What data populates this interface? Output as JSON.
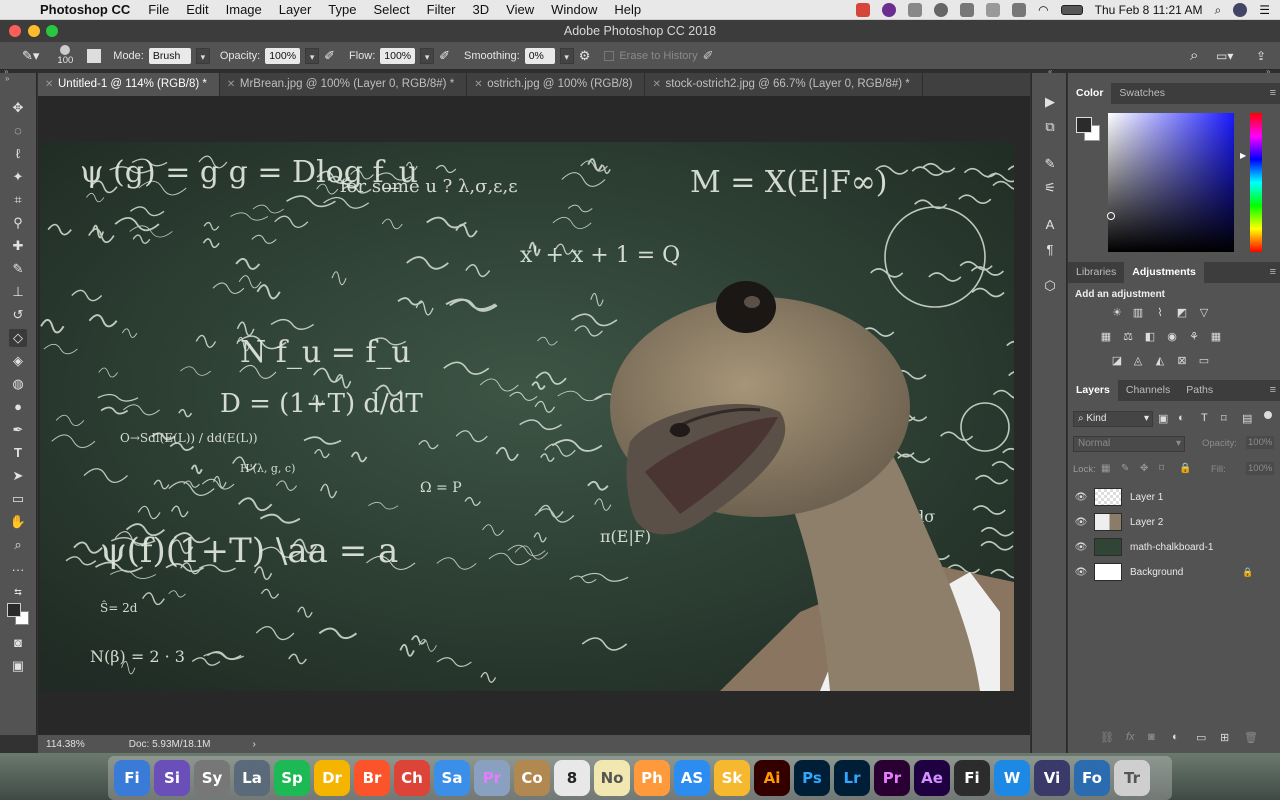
{
  "menubar": {
    "app_name": "Photoshop CC",
    "items": [
      "File",
      "Edit",
      "Image",
      "Layer",
      "Type",
      "Select",
      "Filter",
      "3D",
      "View",
      "Window",
      "Help"
    ],
    "clock": "Thu Feb 8  11:21 AM"
  },
  "window": {
    "title": "Adobe Photoshop CC 2018"
  },
  "options": {
    "brush_size": "100",
    "mode_label": "Mode:",
    "mode_value": "Brush",
    "opacity_label": "Opacity:",
    "opacity_value": "100%",
    "flow_label": "Flow:",
    "flow_value": "100%",
    "smoothing_label": "Smoothing:",
    "smoothing_value": "0%",
    "erase_history": "Erase to History"
  },
  "tabs": [
    {
      "label": "Untitled-1 @ 114% (RGB/8) *",
      "active": true
    },
    {
      "label": "MrBrean.jpg @ 100% (Layer 0, RGB/8#) *"
    },
    {
      "label": "ostrich.jpg @ 100% (RGB/8)"
    },
    {
      "label": "stock-ostrich2.jpg @ 66.7% (Layer 0, RGB/8#) *"
    }
  ],
  "status": {
    "zoom": "114.38%",
    "doc": "Doc: 5.93M/18.1M"
  },
  "color_panel": {
    "tabs": [
      "Color",
      "Swatches"
    ]
  },
  "adjust_panel": {
    "tabs": [
      "Libraries",
      "Adjustments"
    ],
    "heading": "Add an adjustment"
  },
  "layers_panel": {
    "tabs": [
      "Layers",
      "Channels",
      "Paths"
    ],
    "kind": "Kind",
    "blend": "Normal",
    "opacity_label": "Opacity:",
    "opacity_value": "100%",
    "lock_label": "Lock:",
    "fill_label": "Fill:",
    "fill_value": "100%",
    "layers": [
      {
        "name": "Layer 1"
      },
      {
        "name": "Layer 2"
      },
      {
        "name": "math-chalkboard-1"
      },
      {
        "name": "Background"
      }
    ]
  },
  "formulas": [
    "ψ (g) = g   g = Dlog f_u",
    "M = X(E|F∞)",
    "for some u ? λ,σ,ε,ε",
    "N f_u = f_u",
    "D = (1+T) d/dT",
    "ψ(f)(1+T) \\aa = a",
    "x' + x + 1 = Q",
    "N(β) = 2 · 3",
    "Σ ψ dσ",
    "O→Sdl(E(L)) / dd(E(L))",
    "H'(λ, g, c)",
    "Ŝ= 2d",
    "π(E|F)",
    "Ω = P"
  ],
  "dock": {
    "icons": [
      "Fi",
      "Si",
      "Sy",
      "La",
      "Sp",
      "Dr",
      "Br",
      "Ch",
      "Sa",
      "Pr",
      "Co",
      "8",
      "No",
      "Ph",
      "AS",
      "Sk",
      "Ai",
      "Ps",
      "Lr",
      "Pr",
      "Ae",
      "Fi",
      "W",
      "Vi",
      "Fo",
      "Tr"
    ]
  }
}
